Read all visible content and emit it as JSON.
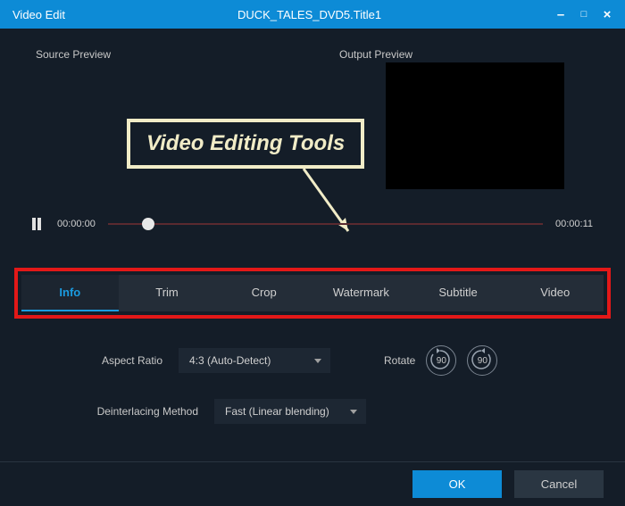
{
  "titlebar": {
    "title": "Video Edit",
    "filename": "DUCK_TALES_DVD5.Title1"
  },
  "preview": {
    "source_label": "Source Preview",
    "output_label": "Output Preview"
  },
  "callout": {
    "text": "Video Editing Tools"
  },
  "playback": {
    "start": "00:00:00",
    "end": "00:00:11"
  },
  "tabs": [
    {
      "label": "Info",
      "active": true
    },
    {
      "label": "Trim",
      "active": false
    },
    {
      "label": "Crop",
      "active": false
    },
    {
      "label": "Watermark",
      "active": false
    },
    {
      "label": "Subtitle",
      "active": false
    },
    {
      "label": "Video",
      "active": false
    }
  ],
  "settings": {
    "aspect_ratio": {
      "label": "Aspect Ratio",
      "value": "4:3 (Auto-Detect)"
    },
    "rotate": {
      "label": "Rotate",
      "ccw": "90",
      "cw": "90"
    },
    "deinterlace": {
      "label": "Deinterlacing Method",
      "value": "Fast (Linear blending)"
    }
  },
  "footer": {
    "ok": "OK",
    "cancel": "Cancel"
  }
}
